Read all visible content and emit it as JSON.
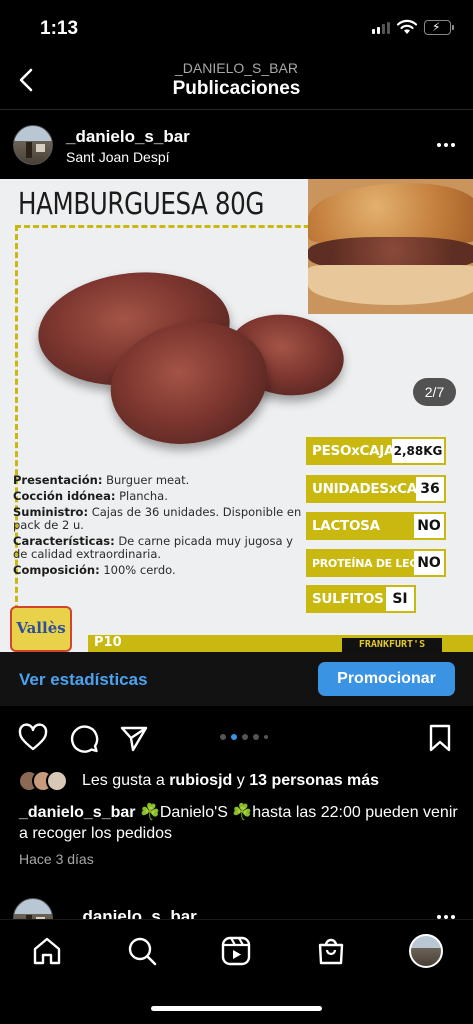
{
  "status": {
    "time": "1:13"
  },
  "header": {
    "subtitle": "_DANIELO_S_BAR",
    "title": "Publicaciones"
  },
  "post": {
    "username": "_danielo_s_bar",
    "location": "Sant Joan Despí",
    "image": {
      "title": "HAMBURGUESA 80G",
      "counter": "2/7",
      "details": [
        {
          "label": "Presentación:",
          "value": "Burguer meat."
        },
        {
          "label": "Cocción idónea:",
          "value": "Plancha."
        },
        {
          "label": "Suministro:",
          "value": "Cajas de 36 unidades. Disponible en pack de 2 u."
        },
        {
          "label": "Características:",
          "value": "De carne picada muy jugosa y de calidad extraordinaria."
        },
        {
          "label": "Composición:",
          "value": "100% cerdo."
        }
      ],
      "specs": [
        {
          "label": "PESOxCAJA",
          "value": "2,88KG"
        },
        {
          "label": "UNIDADESxCAJA",
          "value": "36"
        },
        {
          "label": "LACTOSA",
          "value": "NO"
        },
        {
          "label": "PROTEÍNA DE LECHE",
          "value": "NO"
        },
        {
          "label": "SULFITOS",
          "value": "SI"
        }
      ],
      "logo_text": "Vallès",
      "page": "P10",
      "brand": "FRANKFURT'S"
    },
    "stats_link": "Ver estadísticas",
    "promote_button": "Promocionar",
    "likes": {
      "prefix": "Les gusta a",
      "user": "rubiosjd",
      "connector": "y",
      "others": "13 personas más"
    },
    "caption": {
      "user": "_danielo_s_bar",
      "text": "☘️Danielo'S ☘️hasta las 22:00 pueden venir a recoger los pedidos"
    },
    "time_ago": "Hace 3 días",
    "carousel": {
      "count": 5,
      "active": 1
    }
  },
  "next_post": {
    "username": "_danielo_s_bar"
  },
  "icons": {
    "back": "chevron-left-icon",
    "like": "heart-icon",
    "comment": "comment-icon",
    "share": "send-icon",
    "save": "bookmark-icon",
    "nav": [
      "home-icon",
      "search-icon",
      "reels-icon",
      "shop-icon",
      "profile-avatar"
    ]
  },
  "colors": {
    "accent": "#3b93e3",
    "link": "#4aa3f0",
    "brand_yellow": "#c9b810"
  }
}
